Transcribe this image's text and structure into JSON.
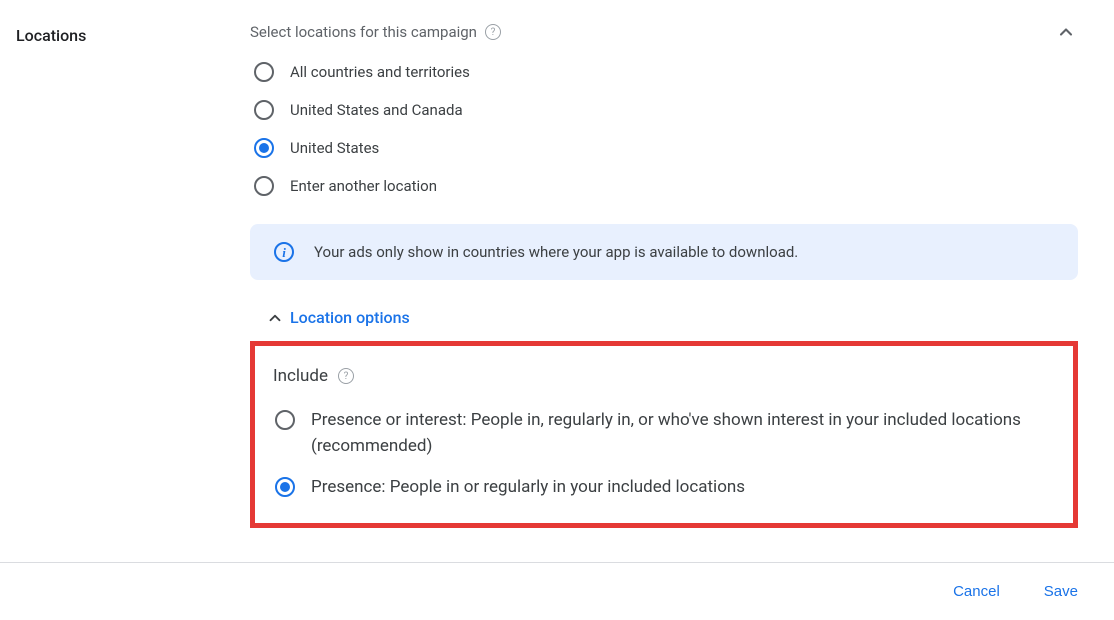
{
  "section": {
    "title": "Locations",
    "subtitle": "Select locations for this campaign"
  },
  "location_radios": {
    "items": [
      {
        "label": "All countries and territories",
        "selected": false
      },
      {
        "label": "United States and Canada",
        "selected": false
      },
      {
        "label": "United States",
        "selected": true
      },
      {
        "label": "Enter another location",
        "selected": false
      }
    ]
  },
  "info_banner": {
    "text": "Your ads only show in countries where your app is available to download."
  },
  "location_options": {
    "toggle_label": "Location options"
  },
  "include": {
    "title": "Include",
    "items": [
      {
        "label": "Presence or interest: People in, regularly in, or who've shown interest in your included locations (recommended)",
        "selected": false
      },
      {
        "label": "Presence: People in or regularly in your included locations",
        "selected": true
      }
    ]
  },
  "footer": {
    "cancel": "Cancel",
    "save": "Save"
  }
}
